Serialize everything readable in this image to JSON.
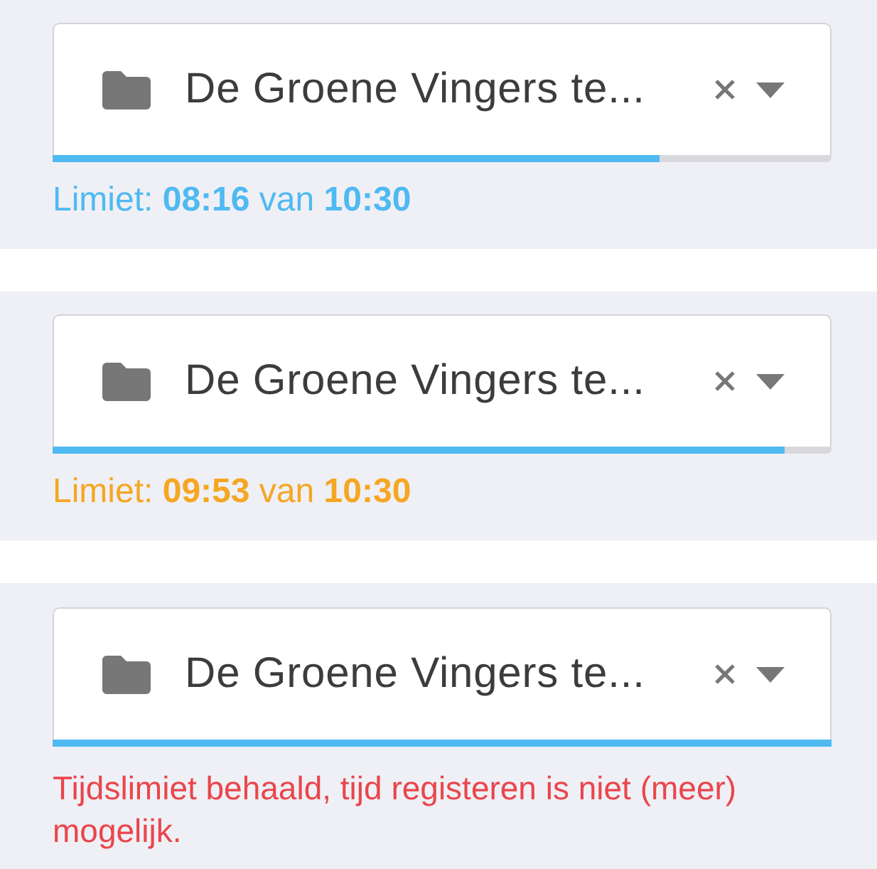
{
  "entries": [
    {
      "project": "De Groene Vingers te...",
      "level": 0.78,
      "message": {
        "kind": "limit",
        "text": "Limiet: **08:16** van **10:30**",
        "color": "#4fb9f2"
      }
    },
    {
      "project": "De Groene Vingers te...",
      "level": 0.94,
      "message": {
        "kind": "limit",
        "text": "Limiet: **09:53** van **10:30**",
        "color": "#f5a623"
      }
    },
    {
      "project": "De Groene Vingers te...",
      "level": 1,
      "message": {
        "kind": "error",
        "text": "Tijdslimiet behaald, tijd registeren is niet (meer) mogelijk.",
        "color": "#e9464c"
      }
    }
  ]
}
